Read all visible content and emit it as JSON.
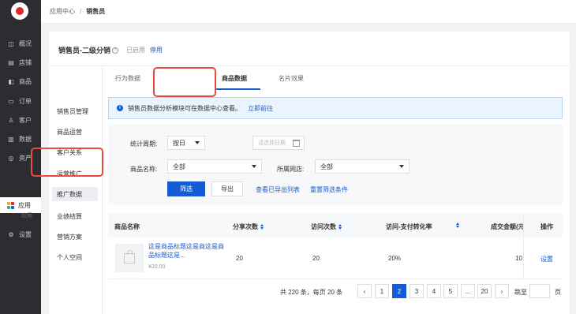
{
  "left_nav": {
    "items": [
      {
        "icon": "overview-icon",
        "glyph": "◫",
        "label": "概况"
      },
      {
        "icon": "store-icon",
        "glyph": "▤",
        "label": "店铺"
      },
      {
        "icon": "goods-icon",
        "glyph": "◧",
        "label": "商品"
      },
      {
        "icon": "order-icon",
        "glyph": "▭",
        "label": "订单"
      },
      {
        "icon": "customer-icon",
        "glyph": "♙",
        "label": "客户"
      },
      {
        "icon": "data-icon",
        "glyph": "▥",
        "label": "数据"
      },
      {
        "icon": "asset-icon",
        "glyph": "◎",
        "label": "资产"
      }
    ],
    "apps_label": "应用",
    "apps_sub_label": "应用",
    "settings_glyph": "⚙",
    "settings_label": "设置"
  },
  "breadcrumb": {
    "parent": "应用中心",
    "separator": "/",
    "current": "销售员"
  },
  "header": {
    "title": "销售员-二级分销",
    "info_glyph": "?",
    "status": "已启用",
    "disable_link": "停用"
  },
  "subnav": {
    "items": [
      "销售员管理",
      "商品运营",
      "客户关系",
      "运营推广",
      "推广数据",
      "业绩结算",
      "营销方案",
      "个人空间"
    ],
    "active_index": 4
  },
  "tabs": {
    "items": [
      "行为数据",
      "商品数据",
      "名片效果"
    ],
    "active_index": 1
  },
  "notice": {
    "icon_glyph": "i",
    "text": "销售员数据分析模块可在数据中心查看。",
    "link": "立即前往"
  },
  "filters": {
    "period_label": "统计周期:",
    "period_value": "按日",
    "date_placeholder": "请选择日期",
    "product_label": "商品名称:",
    "product_value": "全部",
    "store_label": "所属网店:",
    "store_value": "全部",
    "filter_button": "筛选",
    "export_button": "导出",
    "view_exports_link": "查看已导出列表",
    "reset_link": "重置筛选条件"
  },
  "table": {
    "columns": [
      "商品名称",
      "分享次数",
      "访问次数",
      "访问-支付转化率",
      "成交金额(元)",
      "操作"
    ],
    "rows": [
      {
        "name": "这是商品标题这是商这是商品标题这是...",
        "price": "¥20.00",
        "shares": "20",
        "visits": "20",
        "conversion": "20%",
        "amount": "10",
        "action": "设置"
      }
    ]
  },
  "pagination": {
    "summary": "共 220 条，每页 20 条",
    "prev": "‹",
    "pages": [
      "1",
      "2",
      "3",
      "4",
      "5",
      "...",
      "20"
    ],
    "active_page": "2",
    "next": "›",
    "jump_label": "跳至",
    "page_suffix": "页"
  },
  "colors": {
    "accent": "#155bd4",
    "sidebar_bg": "#2b2d31",
    "highlight": "#e94b3c",
    "brand_red": "#e0282f"
  }
}
